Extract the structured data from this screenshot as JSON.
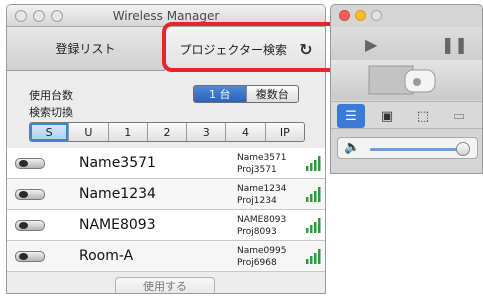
{
  "window": {
    "title": "Wireless Manager"
  },
  "tabs": [
    {
      "label": "登録リスト"
    },
    {
      "label": "プロジェクター検索",
      "refresh_icon": "refresh-icon"
    }
  ],
  "settings": {
    "count_label": "使用台数",
    "count_options": [
      "1 台",
      "複数台"
    ],
    "count_selected": "1 台",
    "switch_label": "検索切換",
    "switch_options": [
      "S",
      "U",
      "1",
      "2",
      "3",
      "4",
      "IP"
    ],
    "switch_selected": "S"
  },
  "projectors": [
    {
      "name": "Name3571",
      "sub1": "Name3571",
      "sub2": "Proj3571"
    },
    {
      "name": "Name1234",
      "sub1": "Name1234",
      "sub2": "Proj1234"
    },
    {
      "name": "NAME8093",
      "sub1": "NAME8093",
      "sub2": "Proj8093"
    },
    {
      "name": "Room-A",
      "sub1": "Name0995",
      "sub2": "Proj6968"
    }
  ],
  "footer": {
    "use_button": "使用する"
  },
  "colors": {
    "highlight": "#e5262b",
    "accent_blue": "#2c63b8"
  },
  "panel": {
    "play_icon": "play-icon",
    "pause_icon": "pause-icon",
    "tools": [
      "list-icon",
      "briefcase-icon",
      "selection-icon",
      "screen-icon"
    ],
    "volume_icon": "speaker-icon",
    "volume_level": 1.0
  }
}
